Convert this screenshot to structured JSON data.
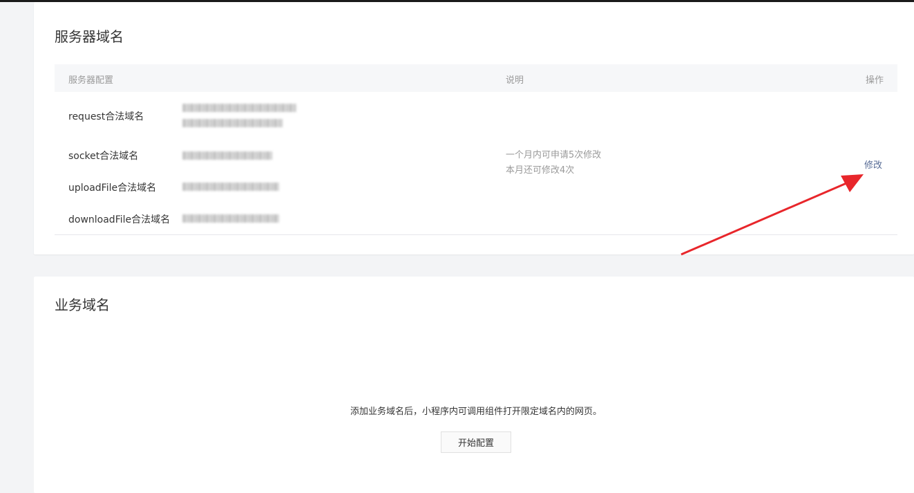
{
  "server_domain": {
    "title": "服务器域名",
    "columns": {
      "config": "服务器配置",
      "desc": "说明",
      "op": "操作"
    },
    "rows": [
      {
        "label": "request合法域名"
      },
      {
        "label": "socket合法域名"
      },
      {
        "label": "uploadFile合法域名"
      },
      {
        "label": "downloadFile合法域名"
      }
    ],
    "desc_line1": "一个月内可申请5次修改",
    "desc_line2": "本月还可修改4次",
    "op_link": "修改"
  },
  "business_domain": {
    "title": "业务域名",
    "empty_text": "添加业务域名后，小程序内可调用组件打开限定域名内的网页。",
    "start_button": "开始配置"
  },
  "annotation": {
    "arrow_color": "#e8262b"
  }
}
